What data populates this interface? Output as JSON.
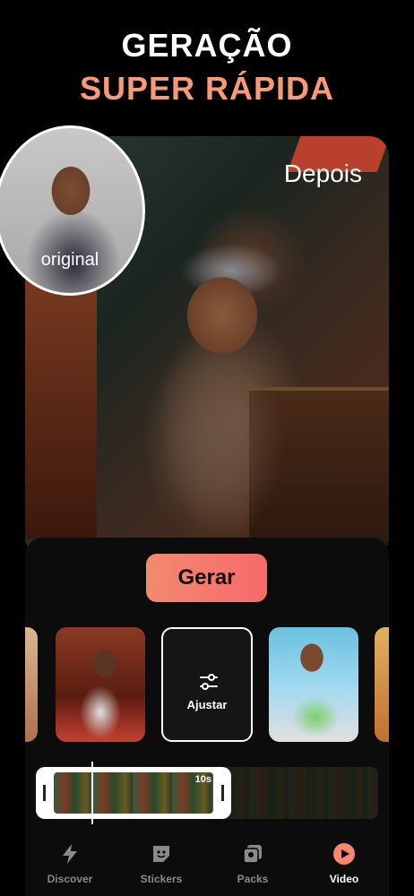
{
  "headline": {
    "line1": "GERAÇÃO",
    "line2": "SUPER RÁPIDA"
  },
  "comparison": {
    "before_label": "original",
    "after_label": "Depois"
  },
  "generate_button": "Gerar",
  "thumbnails": {
    "adjust_label": "Ajustar"
  },
  "timeline": {
    "duration": "10s"
  },
  "tabs": [
    {
      "label": "Discover",
      "icon": "lightning-icon"
    },
    {
      "label": "Stickers",
      "icon": "sticker-icon"
    },
    {
      "label": "Packs",
      "icon": "packs-icon"
    },
    {
      "label": "Video",
      "icon": "play-icon",
      "active": true
    }
  ],
  "colors": {
    "accent": "#f89a78",
    "button_start": "#f28a6e",
    "button_end": "#f76a6a",
    "active_tab_icon": "#f7866e"
  }
}
